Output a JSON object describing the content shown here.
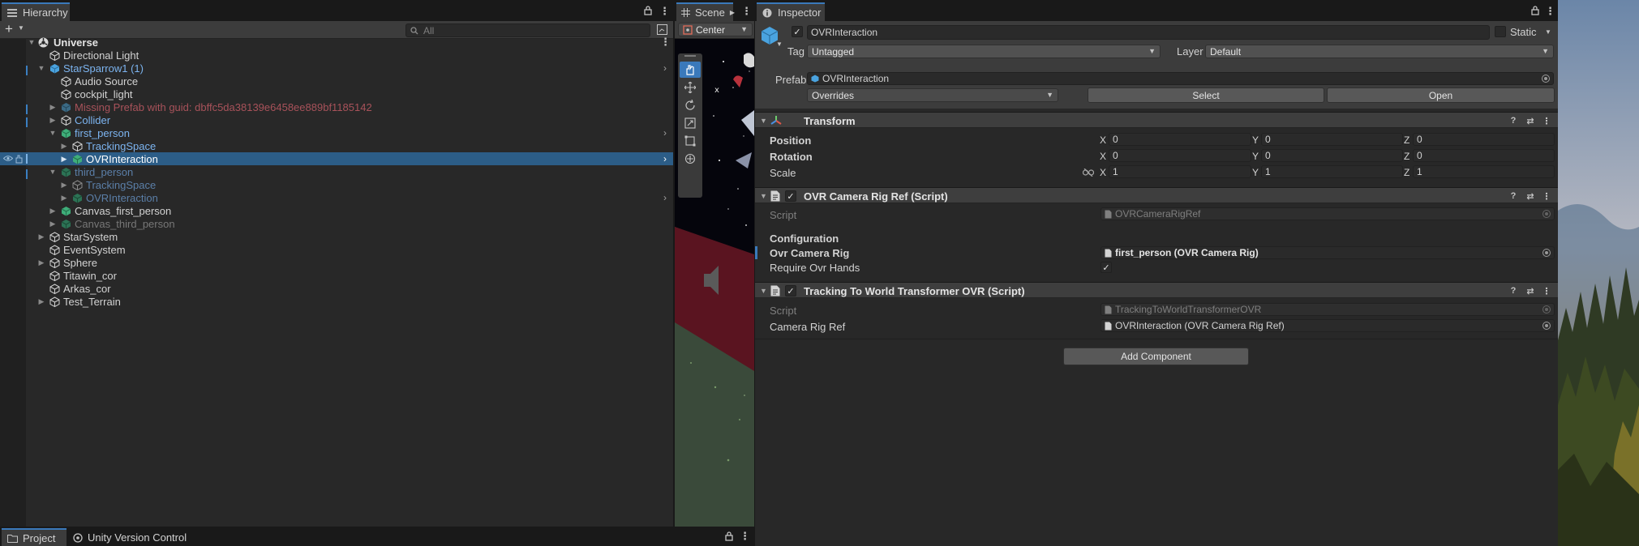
{
  "hierarchy": {
    "tab_label": "Hierarchy",
    "search_placeholder": "All",
    "root": "Universe",
    "rows": [
      {
        "label": "Directional Light",
        "style": "normal"
      },
      {
        "label": "StarSparrow1 (1)",
        "style": "prefab"
      },
      {
        "label": "Audio Source",
        "style": "normal"
      },
      {
        "label": "cockpit_light",
        "style": "normal"
      },
      {
        "label": "Missing Prefab with guid: dbffc5da38139e6458ee889bf1185142",
        "style": "missing"
      },
      {
        "label": "Collider",
        "style": "prefab"
      },
      {
        "label": "first_person",
        "style": "prefab"
      },
      {
        "label": "TrackingSpace",
        "style": "prefab"
      },
      {
        "label": "OVRInteraction",
        "style": "selected"
      },
      {
        "label": "third_person",
        "style": "prefab-dim"
      },
      {
        "label": "TrackingSpace",
        "style": "prefab-dim"
      },
      {
        "label": "OVRInteraction",
        "style": "prefab-dim"
      },
      {
        "label": "Canvas_first_person",
        "style": "normal"
      },
      {
        "label": "Canvas_third_person",
        "style": "disabled"
      },
      {
        "label": "StarSystem",
        "style": "normal"
      },
      {
        "label": "EventSystem",
        "style": "normal"
      },
      {
        "label": "Sphere",
        "style": "normal"
      },
      {
        "label": "Titawin_cor",
        "style": "normal"
      },
      {
        "label": "Arkas_cor",
        "style": "normal"
      },
      {
        "label": "Test_Terrain",
        "style": "normal"
      }
    ]
  },
  "bottom_tabs": {
    "project": "Project",
    "version_control": "Unity Version Control"
  },
  "scene": {
    "tab_label": "Scene",
    "pivot_mode": "Center"
  },
  "inspector": {
    "tab_label": "Inspector",
    "object_name": "OVRInteraction",
    "static_label": "Static",
    "tag_label": "Tag",
    "tag_value": "Untagged",
    "layer_label": "Layer",
    "layer_value": "Default",
    "prefab_label": "Prefab",
    "prefab_value": "OVRInteraction",
    "overrides_label": "Overrides",
    "select_label": "Select",
    "open_label": "Open",
    "transform": {
      "title": "Transform",
      "position_label": "Position",
      "rotation_label": "Rotation",
      "scale_label": "Scale",
      "axis_x": "X",
      "axis_y": "Y",
      "axis_z": "Z",
      "position": [
        "0",
        "0",
        "0"
      ],
      "rotation": [
        "0",
        "0",
        "0"
      ],
      "scale": [
        "1",
        "1",
        "1"
      ]
    },
    "camera_rig_ref": {
      "title": "OVR Camera Rig Ref (Script)",
      "script_label": "Script",
      "script_value": "OVRCameraRigRef",
      "section": "Configuration",
      "rig_label": "Ovr Camera Rig",
      "rig_value": "first_person (OVR Camera Rig)",
      "hands_label": "Require Ovr Hands"
    },
    "tracking": {
      "title": "Tracking To World Transformer OVR (Script)",
      "script_label": "Script",
      "script_value": "TrackingToWorldTransformerOVR",
      "rigref_label": "Camera Rig Ref",
      "rigref_value": "OVRInteraction (OVR Camera Rig Ref)"
    },
    "add_component": "Add Component"
  },
  "colors": {
    "accent": "#3a79bb",
    "selection": "#2c5d87",
    "prefab_text": "#7cb4f0",
    "missing_text": "#a8525a"
  }
}
